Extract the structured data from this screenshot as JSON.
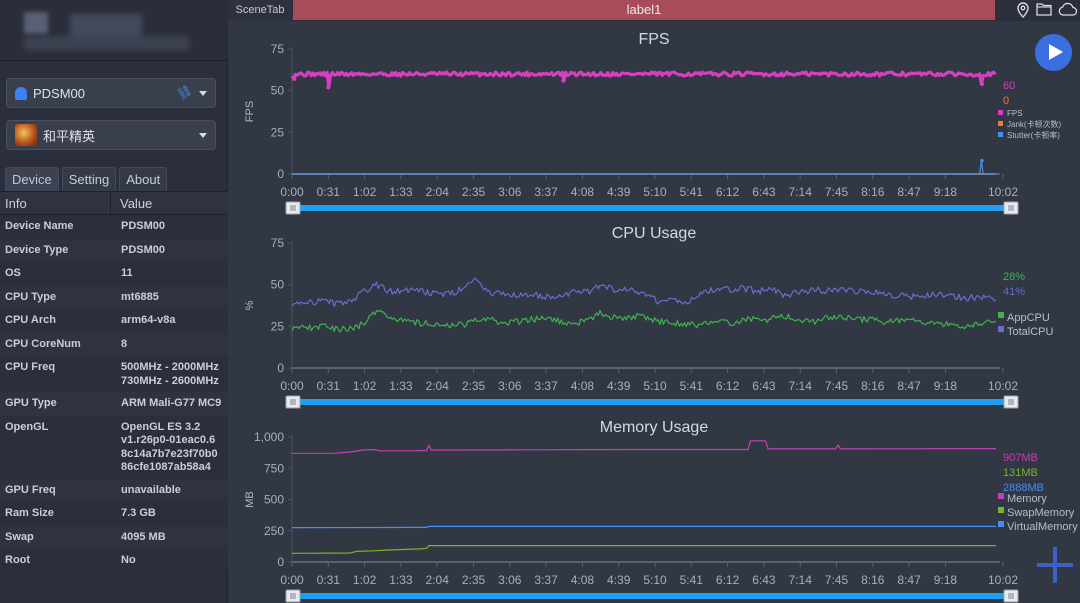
{
  "sidebar": {
    "device_select": {
      "value": "PDSM00",
      "icon": "android-icon",
      "link_icon": "link-icon"
    },
    "app_select": {
      "value": "和平精英",
      "icon": "game-icon"
    },
    "tabs": [
      {
        "label": "Device",
        "active": true
      },
      {
        "label": "Setting",
        "active": false
      },
      {
        "label": "About",
        "active": false
      }
    ],
    "table": {
      "headers": [
        "Info",
        "Value"
      ],
      "rows": [
        {
          "key": "Device Name",
          "value": "PDSM00"
        },
        {
          "key": "Device Type",
          "value": "PDSM00"
        },
        {
          "key": "OS",
          "value": "11"
        },
        {
          "key": "CPU Type",
          "value": "mt6885"
        },
        {
          "key": "CPU Arch",
          "value": "arm64-v8a"
        },
        {
          "key": "CPU CoreNum",
          "value": "8"
        },
        {
          "key": "CPU Freq",
          "value": "500MHz - 2000MHz\n730MHz - 2600MHz"
        },
        {
          "key": "GPU Type",
          "value": "ARM Mali-G77 MC9"
        },
        {
          "key": "OpenGL",
          "value": "OpenGL ES 3.2\nv1.r26p0-01eac0.6\n8c14a7b7e23f70b0\n86cfe1087ab58a4"
        },
        {
          "key": "GPU Freq",
          "value": "unavailable"
        },
        {
          "key": "Ram Size",
          "value": "7.3 GB"
        },
        {
          "key": "Swap",
          "value": "4095 MB"
        },
        {
          "key": "Root",
          "value": "No"
        }
      ]
    }
  },
  "topbar": {
    "scene_tab": "SceneTab",
    "label_tab": "label1",
    "label_color": "#a84c5a",
    "icons": [
      "location-pin-icon",
      "folder-icon",
      "cloud-icon"
    ]
  },
  "buttons": {
    "play": "play-icon",
    "add": "plus-icon"
  },
  "chart_data": [
    {
      "type": "line",
      "title": "FPS",
      "ylabel": "FPS",
      "ylim": [
        0,
        75
      ],
      "yticks": [
        "0",
        "25",
        "50",
        "75"
      ],
      "x": [
        "0:00",
        "0:31",
        "1:02",
        "1:33",
        "2:04",
        "2:35",
        "3:06",
        "3:37",
        "4:08",
        "4:39",
        "5:10",
        "5:41",
        "6:12",
        "6:43",
        "7:14",
        "7:45",
        "8:16",
        "8:47",
        "9:18",
        "10:02"
      ],
      "duration_s": 602,
      "series": [
        {
          "name": "FPS",
          "color": "#d63fbf",
          "current": "60",
          "baseline": 60,
          "dips": [
            [
              2,
              57
            ],
            [
              31,
              52
            ],
            [
              232,
              56
            ],
            [
              590,
              54
            ]
          ]
        },
        {
          "name": "Jank(卡顿次数)",
          "color": "#f07a2a",
          "current": "0",
          "baseline": 0,
          "spikes": []
        },
        {
          "name": "Stutter(卡顿率)",
          "color": "#4a8cf0",
          "baseline": 0,
          "spikes": [
            [
              590,
              8
            ]
          ]
        }
      ],
      "legend": "right"
    },
    {
      "type": "line",
      "title": "CPU Usage",
      "ylabel": "%",
      "ylim": [
        0,
        75
      ],
      "yticks": [
        "0",
        "25",
        "50",
        "75"
      ],
      "x": [
        "0:00",
        "0:31",
        "1:02",
        "1:33",
        "2:04",
        "2:35",
        "3:06",
        "3:37",
        "4:08",
        "4:39",
        "5:10",
        "5:41",
        "6:12",
        "6:43",
        "7:14",
        "7:45",
        "8:16",
        "8:47",
        "9:18",
        "10:02"
      ],
      "duration_s": 602,
      "series": [
        {
          "name": "AppCPU",
          "color": "#3fb24f",
          "current": "28%",
          "values": [
            24,
            24,
            25,
            24,
            23,
            26,
            35,
            30,
            29,
            27,
            27,
            25,
            26,
            28,
            29,
            27,
            28,
            29,
            30,
            28,
            26,
            29,
            33,
            30,
            31,
            31,
            28,
            27,
            26,
            26,
            27,
            27,
            28,
            30,
            29,
            31,
            29,
            28,
            30,
            31,
            29,
            29,
            28,
            28,
            28,
            27,
            26,
            26,
            25,
            26,
            28
          ]
        },
        {
          "name": "TotalCPU",
          "color": "#6b6ccf",
          "current": "41%",
          "values": [
            39,
            39,
            40,
            39,
            40,
            45,
            50,
            46,
            47,
            46,
            45,
            44,
            47,
            52,
            45,
            45,
            44,
            44,
            43,
            43,
            45,
            46,
            49,
            47,
            48,
            45,
            40,
            41,
            39,
            45,
            47,
            47,
            48,
            46,
            47,
            44,
            45,
            47,
            46,
            47,
            46,
            45,
            45,
            43,
            43,
            44,
            44,
            43,
            42,
            43,
            41
          ]
        }
      ],
      "legend": "right"
    },
    {
      "type": "line",
      "title": "Memory Usage",
      "ylabel": "MB",
      "ylim": [
        0,
        1000
      ],
      "yticks": [
        "0",
        "250",
        "500",
        "750",
        "1,000"
      ],
      "x": [
        "0:00",
        "0:31",
        "1:02",
        "1:33",
        "2:04",
        "2:35",
        "3:06",
        "3:37",
        "4:08",
        "4:39",
        "5:10",
        "5:41",
        "6:12",
        "6:43",
        "7:14",
        "7:45",
        "8:16",
        "8:47",
        "9:18",
        "10:02"
      ],
      "duration_s": 602,
      "series": [
        {
          "name": "Memory",
          "color": "#c43fb6",
          "current": "907MB",
          "points": [
            [
              0,
              870
            ],
            [
              35,
              870
            ],
            [
              50,
              880
            ],
            [
              60,
              895
            ],
            [
              70,
              900
            ],
            [
              75,
              890
            ],
            [
              100,
              890
            ],
            [
              115,
              892
            ],
            [
              117,
              935
            ],
            [
              119,
              895
            ],
            [
              200,
              898
            ],
            [
              300,
              900
            ],
            [
              390,
              900
            ],
            [
              392,
              970
            ],
            [
              405,
              970
            ],
            [
              407,
              905
            ],
            [
              465,
              905
            ],
            [
              467,
              935
            ],
            [
              469,
              905
            ],
            [
              602,
              907
            ]
          ]
        },
        {
          "name": "SwapMemory",
          "color": "#7ab32a",
          "current": "131MB",
          "points": [
            [
              0,
              70
            ],
            [
              50,
              72
            ],
            [
              55,
              85
            ],
            [
              70,
              90
            ],
            [
              80,
              95
            ],
            [
              110,
              105
            ],
            [
              115,
              110
            ],
            [
              117,
              131
            ],
            [
              602,
              131
            ]
          ]
        },
        {
          "name": "VirtualMemory",
          "color": "#4a8cf0",
          "current": "2888MB",
          "points": [
            [
              0,
              275
            ],
            [
              115,
              277
            ],
            [
              117,
              285
            ],
            [
              602,
              285
            ]
          ]
        }
      ],
      "legend": "right"
    }
  ]
}
